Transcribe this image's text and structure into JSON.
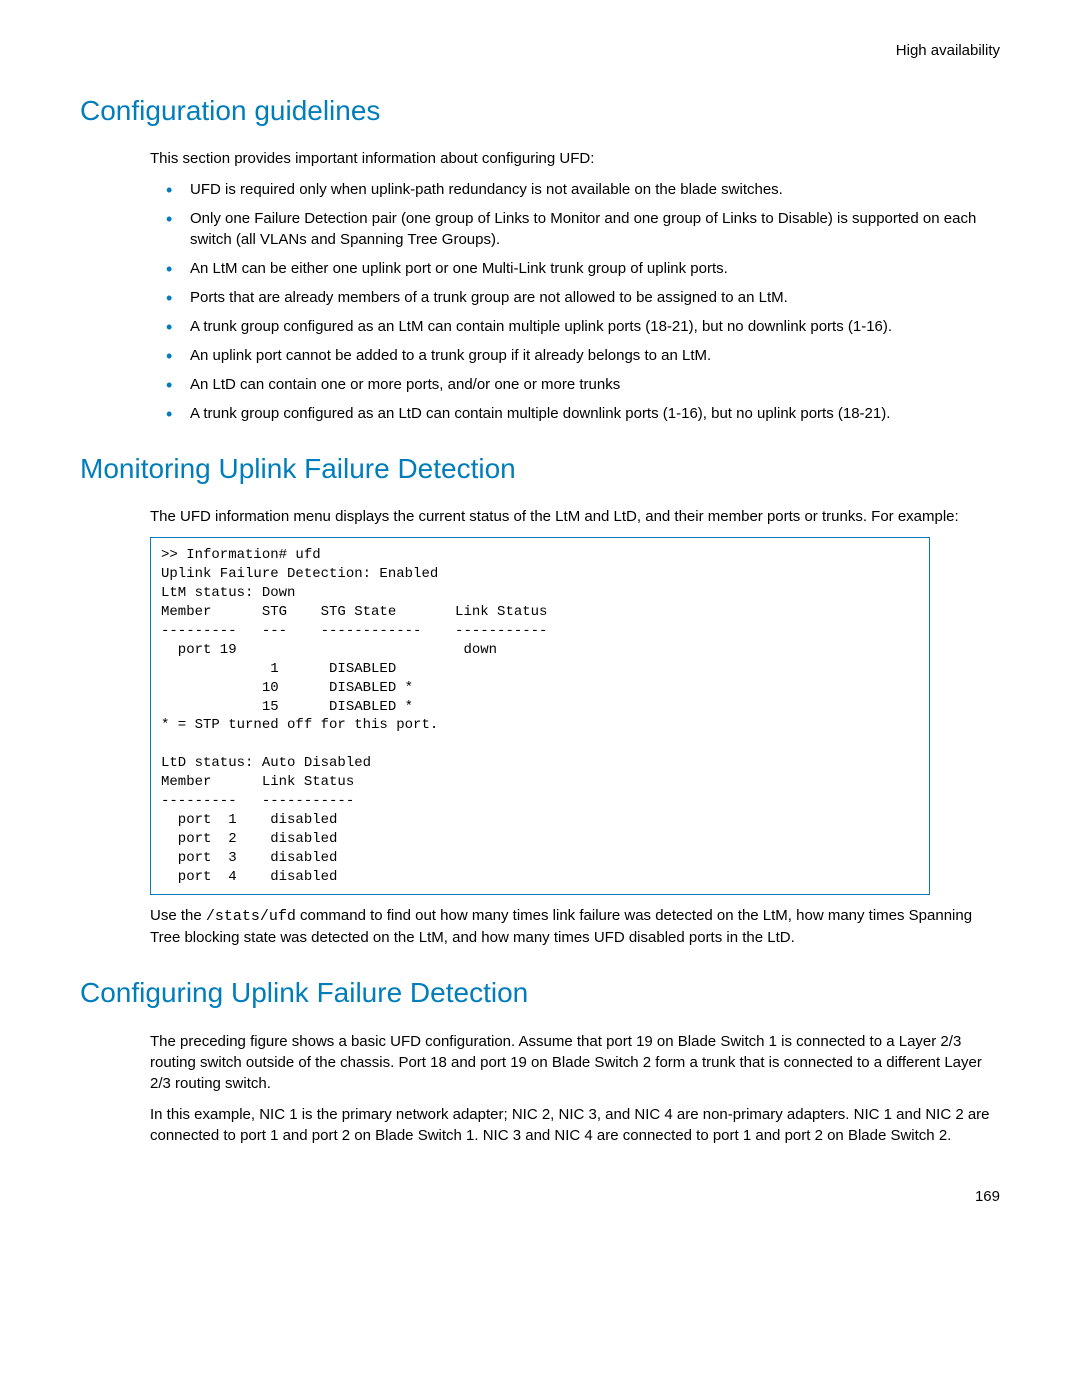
{
  "header": {
    "right": "High availability"
  },
  "sections": {
    "config_guidelines": {
      "title": "Configuration guidelines",
      "intro": "This section provides important information about configuring UFD:",
      "bullets": [
        "UFD is required only when uplink-path redundancy is not available on the blade switches.",
        "Only one Failure Detection pair (one group of Links to Monitor and one group of Links to Disable) is supported on each switch (all VLANs and Spanning Tree Groups).",
        "An LtM can be either one uplink port or one Multi-Link trunk group of uplink ports.",
        "Ports that are already members of a trunk group are not allowed to be assigned to an LtM.",
        "A trunk group configured as an LtM can contain multiple uplink ports (18-21), but no downlink ports (1-16).",
        "An uplink port cannot be added to a trunk group if it already belongs to an LtM.",
        "An LtD can contain one or more ports, and/or one or more trunks",
        "A trunk group configured as an LtD can contain multiple downlink ports (1-16), but no uplink ports (18-21)."
      ]
    },
    "monitoring_ufd": {
      "title": "Monitoring Uplink Failure Detection",
      "intro": "The UFD information menu displays the current status of the LtM and LtD, and their member ports or trunks. For example:",
      "code": ">> Information# ufd\nUplink Failure Detection: Enabled\nLtM status: Down\nMember      STG    STG State       Link Status\n---------   ---    ------------    -----------\n  port 19                           down\n             1      DISABLED\n            10      DISABLED *\n            15      DISABLED *\n* = STP turned off for this port.\n\nLtD status: Auto Disabled\nMember      Link Status\n---------   -----------\n  port  1    disabled\n  port  2    disabled\n  port  3    disabled\n  port  4    disabled",
      "post_code_prefix": "Use the ",
      "post_code_cmd": "/stats/ufd",
      "post_code_suffix": " command to find out how many times link failure was detected on the LtM, how many times Spanning Tree blocking state was detected on the LtM, and how many times UFD disabled ports in the LtD."
    },
    "configuring_ufd": {
      "title": "Configuring Uplink Failure Detection",
      "p1": "The preceding figure shows a basic UFD configuration. Assume that port 19 on Blade Switch 1 is connected to a Layer 2/3 routing switch outside of the chassis. Port 18 and port 19 on Blade Switch 2 form a trunk that is connected to a different Layer 2/3 routing switch.",
      "p2": "In this example, NIC 1 is the primary network adapter; NIC 2, NIC 3, and NIC 4 are non-primary adapters. NIC 1 and NIC 2 are connected to port 1 and port 2 on Blade Switch 1. NIC 3 and NIC 4 are connected to port 1 and port 2 on Blade Switch 2."
    }
  },
  "page_number": "169"
}
